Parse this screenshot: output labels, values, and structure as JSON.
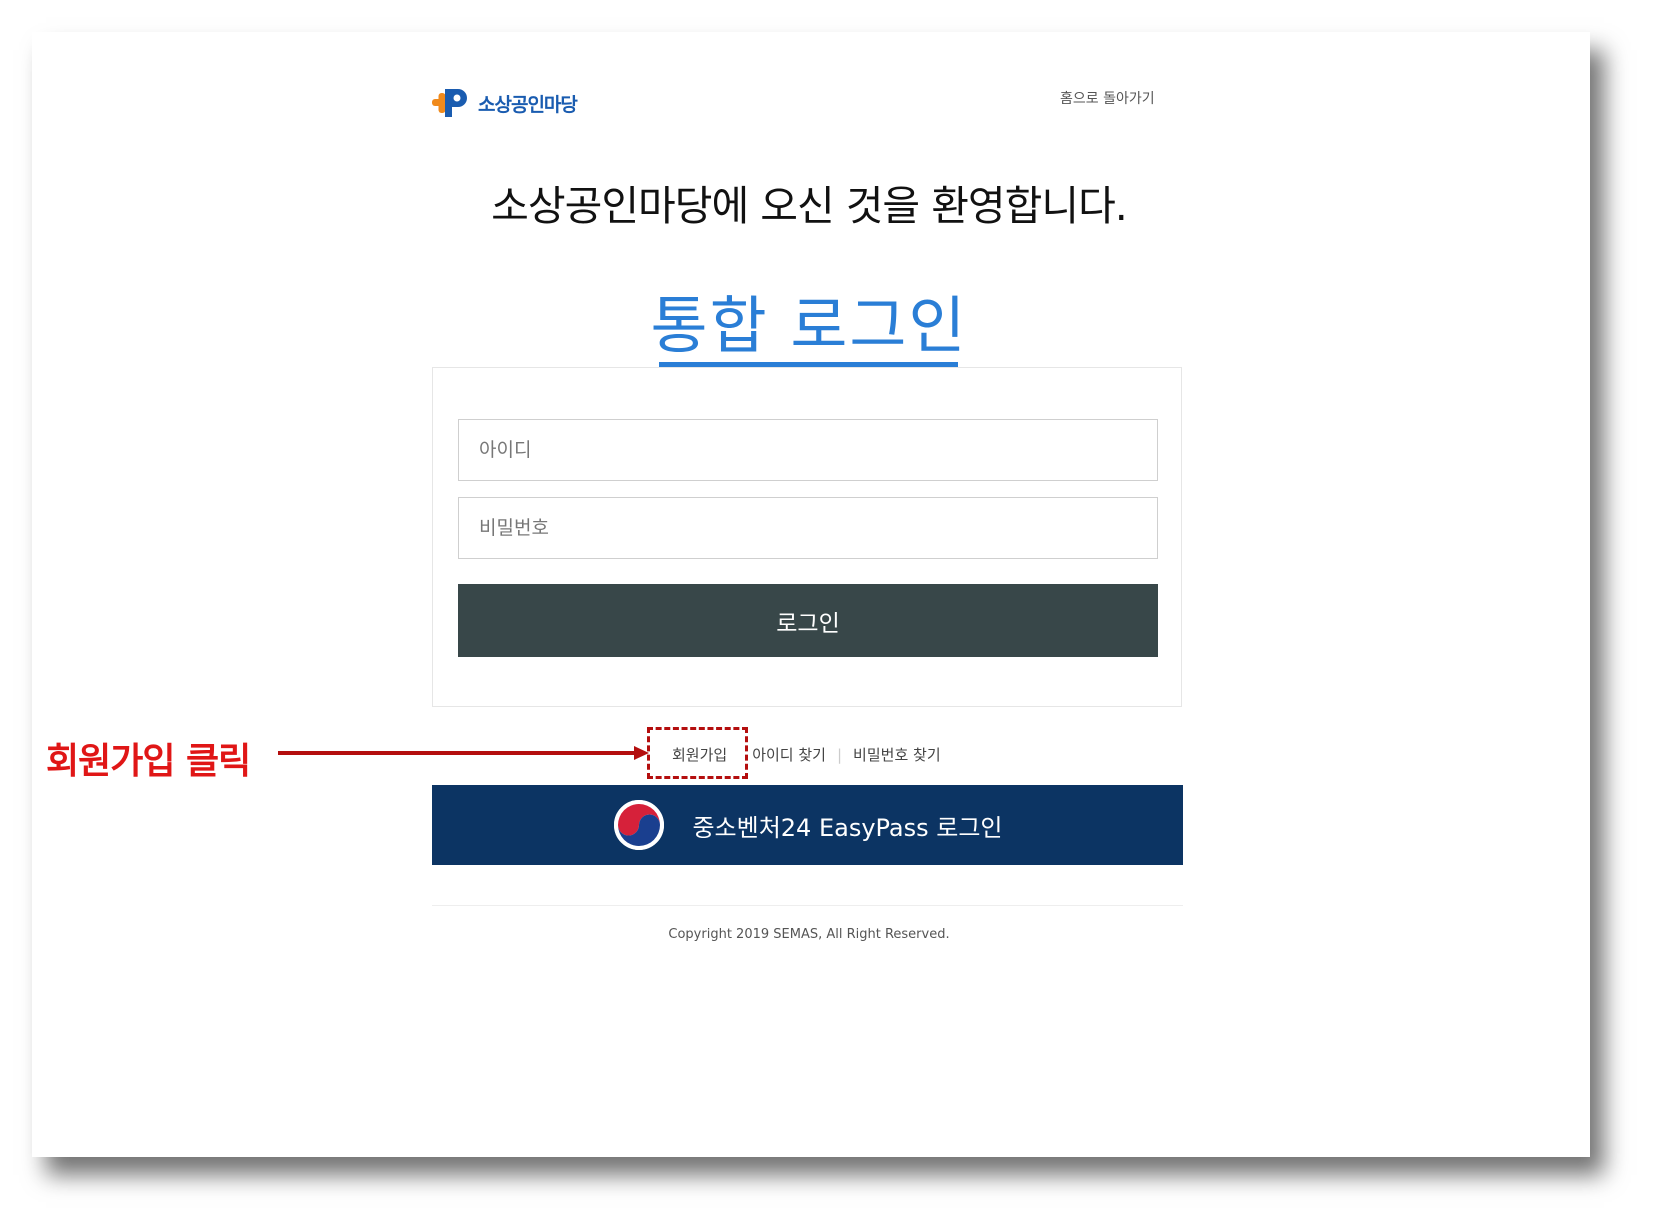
{
  "header": {
    "logo_text": "소상공인마당",
    "home_link": "홈으로 돌아가기"
  },
  "welcome_text": "소상공인마당에 오신 것을 환영합니다.",
  "login_title": "통합 로그인",
  "form": {
    "id_placeholder": "아이디",
    "pw_placeholder": "비밀번호",
    "login_button": "로그인"
  },
  "links": {
    "join": "회원가입",
    "find_id": "아이디 찾기",
    "find_pw": "비밀번호 찾기",
    "separator": "|"
  },
  "easypass": {
    "label": "중소벤처24 EasyPass 로그인",
    "icon": "taegeuk-emblem-icon"
  },
  "footer": {
    "copyright": "Copyright 2019 SEMAS, All Right Reserved."
  },
  "annotation": {
    "label": "회원가입 클릭",
    "color": "#e01616"
  },
  "colors": {
    "accent": "#2a7ed6",
    "login_button": "#384749",
    "easypass_bg": "#0c3463",
    "logo_orange": "#f08a1c",
    "logo_blue": "#1a5cb0"
  }
}
